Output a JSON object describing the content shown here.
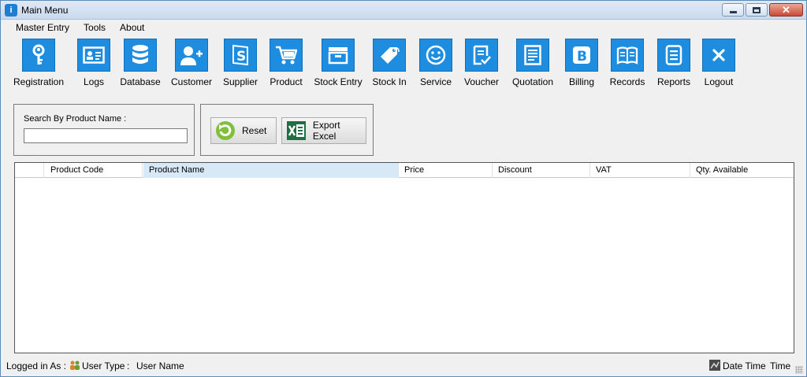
{
  "window": {
    "title": "Main Menu"
  },
  "menu": [
    "Master Entry",
    "Tools",
    "About"
  ],
  "toolbar": [
    {
      "label": "Registration",
      "icon": "key-icon"
    },
    {
      "label": "Logs",
      "icon": "id-card-icon"
    },
    {
      "label": "Database",
      "icon": "database-icon"
    },
    {
      "label": "Customer",
      "icon": "add-user-icon"
    },
    {
      "label": "Supplier",
      "icon": "supplier-s-icon"
    },
    {
      "label": "Product",
      "icon": "cart-icon"
    },
    {
      "label": "Stock Entry",
      "icon": "inbox-icon"
    },
    {
      "label": "Stock In",
      "icon": "tag-icon"
    },
    {
      "label": "Service",
      "icon": "smiley-icon"
    },
    {
      "label": "Voucher",
      "icon": "checklist-icon"
    },
    {
      "label": "Quotation",
      "icon": "document-icon"
    },
    {
      "label": "Billing",
      "icon": "b-letter-icon"
    },
    {
      "label": "Records",
      "icon": "book-icon"
    },
    {
      "label": "Reports",
      "icon": "report-icon"
    },
    {
      "label": "Logout",
      "icon": "close-icon"
    }
  ],
  "search": {
    "label": "Search By Product Name :",
    "value": ""
  },
  "buttons": {
    "reset": "Reset",
    "export": "Export Excel"
  },
  "grid": {
    "columns": [
      "",
      "Product Code",
      "Product Name",
      "Price",
      "Discount",
      "VAT",
      "Qty. Available"
    ],
    "rows": []
  },
  "status": {
    "logged_in": "Logged in As :",
    "user_type": "User Type",
    "separator": ":",
    "user_name": "User Name",
    "date_time": "Date Time",
    "time": "Time"
  },
  "colors": {
    "accent": "#1e8de0",
    "header_selected": "#d7e8f7"
  }
}
